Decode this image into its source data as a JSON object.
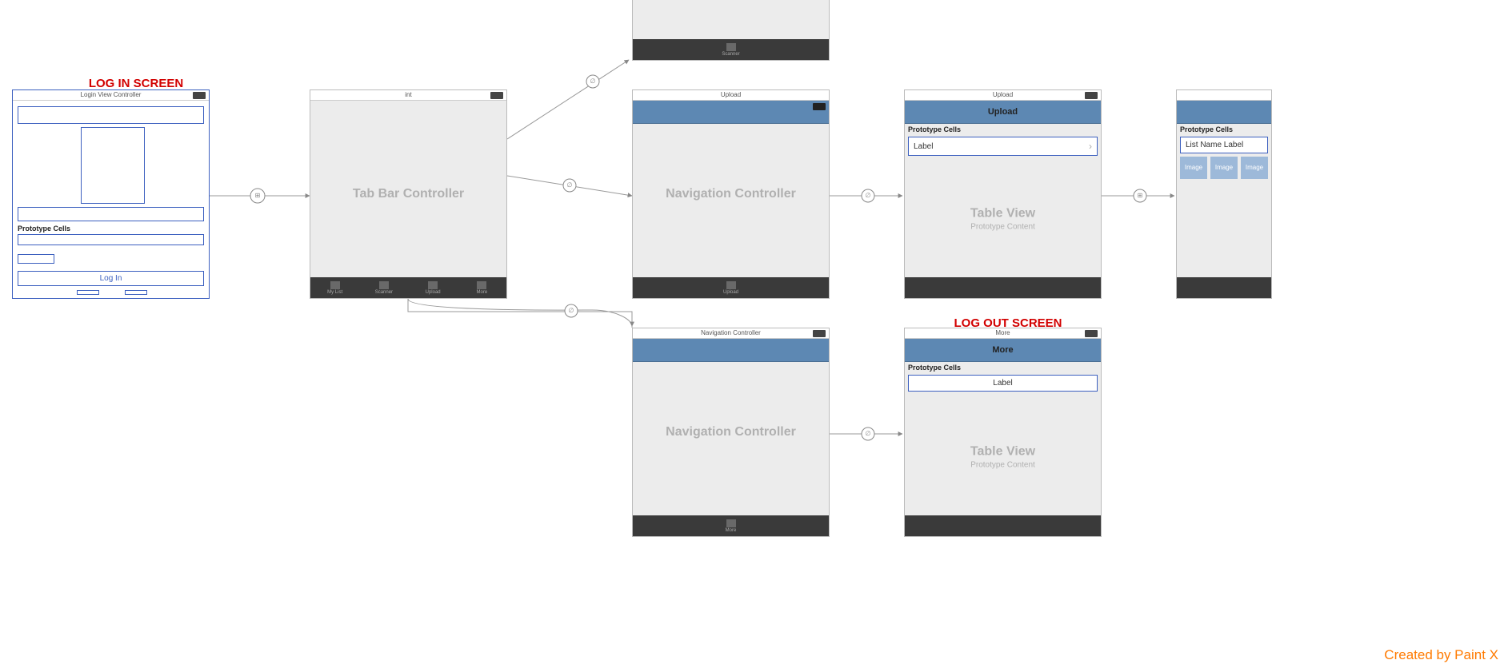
{
  "annotations": {
    "login": "LOG IN SCREEN",
    "logout": "LOG OUT SCREEN"
  },
  "watermark": "Created by Paint X",
  "login_screen": {
    "title": "Login View Controller",
    "prototype_header": "Prototype Cells",
    "login_button": "Log In"
  },
  "tabbar_controller": {
    "title": "int",
    "center": "Tab Bar Controller",
    "tabs": [
      "My List",
      "Scanner",
      "Upload",
      "More"
    ]
  },
  "partial_top": {
    "tabs": [
      "Scanner"
    ]
  },
  "nav_upload": {
    "title": "Upload",
    "center": "Navigation Controller",
    "tabs": [
      "Upload"
    ]
  },
  "table_upload": {
    "title": "Upload",
    "nav_title": "Upload",
    "proto_header": "Prototype Cells",
    "cell_label": "Label",
    "center": "Table View",
    "center_sub": "Prototype Content"
  },
  "partial_right": {
    "proto_header": "Prototype Cells",
    "cell_label": "List Name Label",
    "chips": [
      "Image",
      "Image",
      "Image"
    ]
  },
  "nav_more": {
    "title": "Navigation Controller",
    "center": "Navigation Controller",
    "tabs": [
      "More"
    ]
  },
  "table_more": {
    "title": "More",
    "nav_title": "More",
    "proto_header": "Prototype Cells",
    "cell_label": "Label",
    "center": "Table View",
    "center_sub": "Prototype Content"
  }
}
